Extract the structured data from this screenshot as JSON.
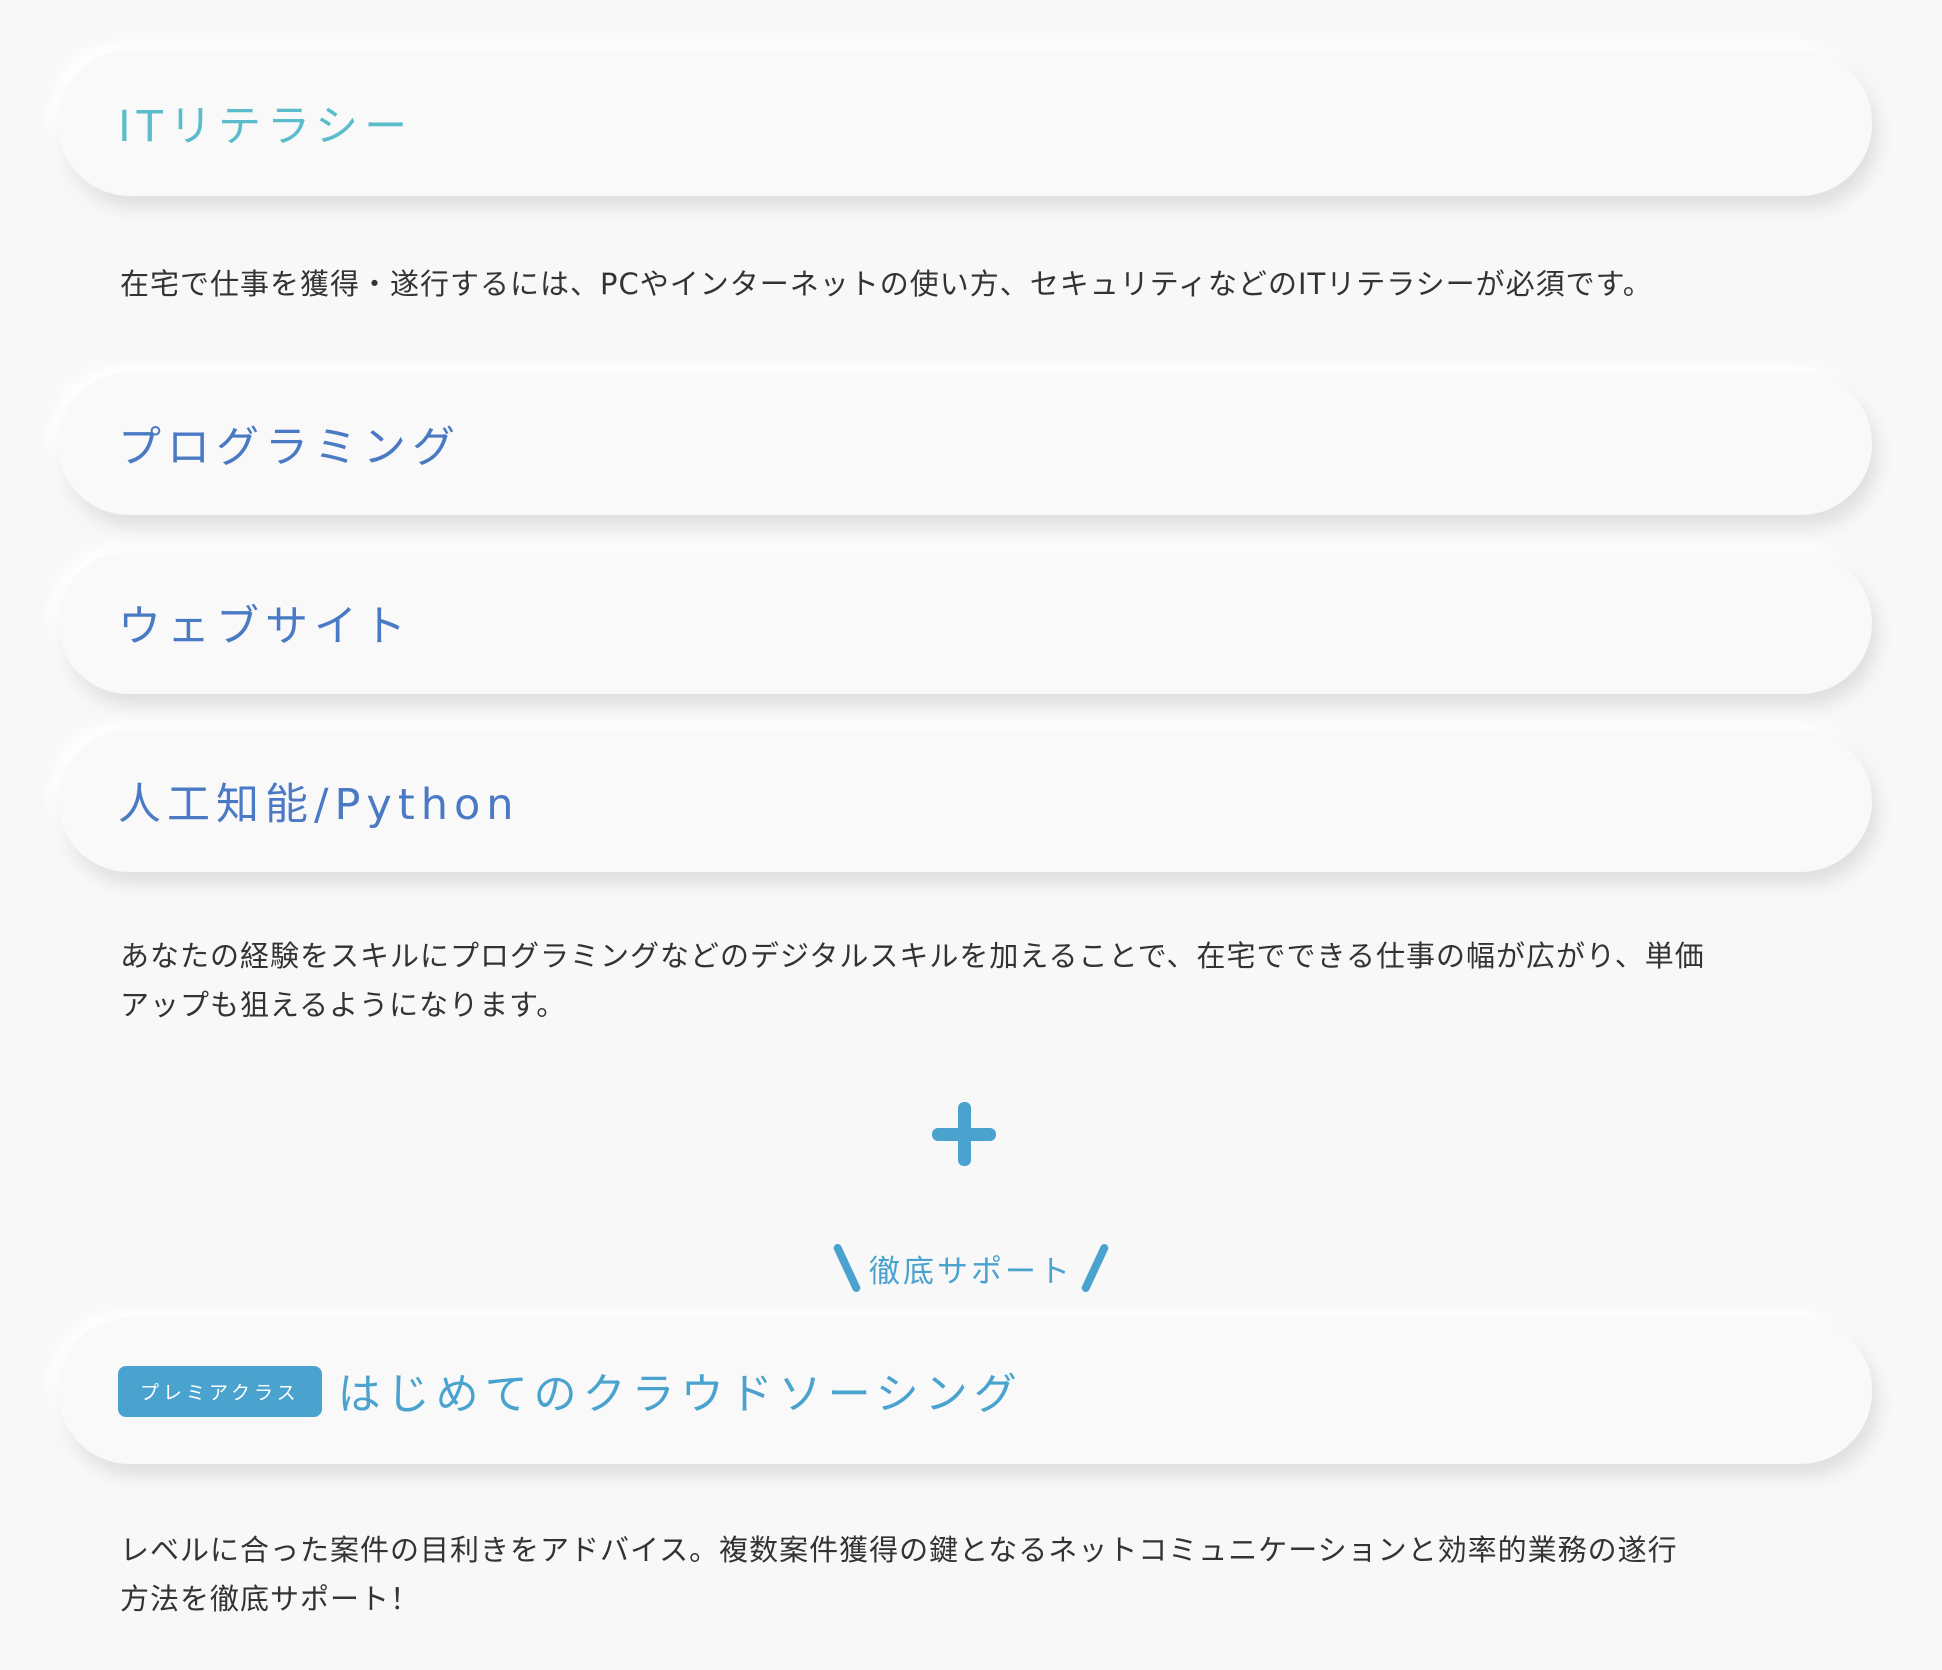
{
  "sections": {
    "it_literacy": {
      "title": "ITリテラシー",
      "description": "在宅で仕事を獲得・遂行するには、PCやインターネットの使い方、セキュリティなどのITリテラシーが必須です。"
    },
    "programming": {
      "title": "プログラミング"
    },
    "website": {
      "title": "ウェブサイト"
    },
    "ai_python": {
      "title": "人工知能/Python"
    },
    "digital_skills": {
      "description_line1": "あなたの経験をスキルにプログラミングなどのデジタルスキルを加えることで、在宅でできる仕事の幅が広がり、単価",
      "description_line2": "アップも狙えるようになります。"
    },
    "plus_icon": "plus-icon",
    "support": {
      "label": "徹底サポート"
    },
    "crowdsourcing": {
      "badge": "プレミアクラス",
      "title": "はじめてのクラウドソーシング",
      "description_line1": "レベルに合った案件の目利きをアドバイス。複数案件獲得の鍵となるネットコミュニケーションと効率的業務の遂行",
      "description_line2": "方法を徹底サポート！"
    }
  },
  "colors": {
    "background": "#f8f8f8",
    "teal": "#5bbccc",
    "blue": "#4a7ac4",
    "sky": "#4aa3cf",
    "text": "#333333"
  }
}
